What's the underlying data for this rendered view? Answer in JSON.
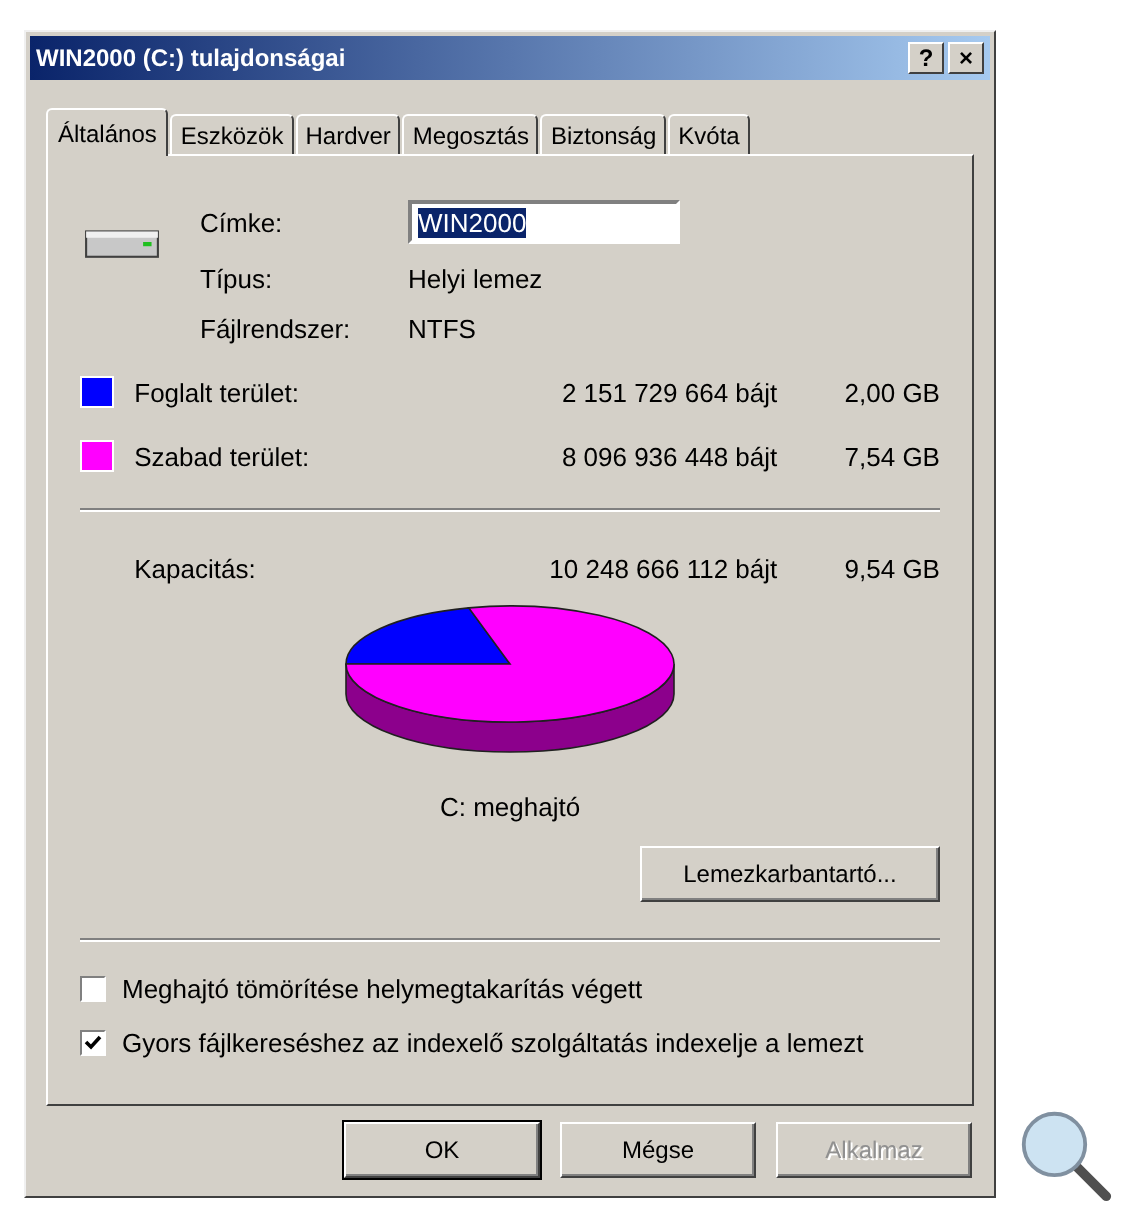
{
  "window": {
    "title": "WIN2000 (C:) tulajdonságai",
    "title_buttons": [
      "?",
      "×"
    ]
  },
  "tabs": [
    {
      "label": "Általános",
      "selected": true
    },
    {
      "label": "Eszközök",
      "selected": false
    },
    {
      "label": "Hardver",
      "selected": false
    },
    {
      "label": "Megosztás",
      "selected": false
    },
    {
      "label": "Biztonság",
      "selected": false
    },
    {
      "label": "Kvóta",
      "selected": false
    }
  ],
  "drive": {
    "label_field": {
      "label": "Címke:",
      "value": "WIN2000",
      "text_selected": true
    },
    "properties": [
      {
        "label": "Típus:",
        "value": "Helyi lemez"
      },
      {
        "label": "Fájlrendszer:",
        "value": "NTFS"
      }
    ]
  },
  "usage": [
    {
      "label": "Foglalt terület:",
      "bytes": "2 151 729 664 bájt",
      "size": "2,00 GB",
      "color": "#0000ff"
    },
    {
      "label": "Szabad terület:",
      "bytes": "8 096 936 448 bájt",
      "size": "7,54 GB",
      "color": "#ff00ff"
    }
  ],
  "capacity": {
    "label": "Kapacitás:",
    "bytes": "10 248 666 112 bájt",
    "size": "9,54 GB"
  },
  "chart": {
    "caption": "C: meghajtó"
  },
  "cleanup_button": "Lemezkarbantartó...",
  "options": [
    {
      "label": "Meghajtó tömörítése helymegtakarítás végett",
      "checked": false
    },
    {
      "label": "Gyors fájlkereséshez az indexelő szolgáltatás indexelje a lemezt",
      "checked": true
    }
  ],
  "buttons": [
    {
      "label": "OK",
      "default": true,
      "disabled": false
    },
    {
      "label": "Mégse",
      "default": false,
      "disabled": false
    },
    {
      "label": "Alkalmaz",
      "default": false,
      "disabled": true
    }
  ]
}
